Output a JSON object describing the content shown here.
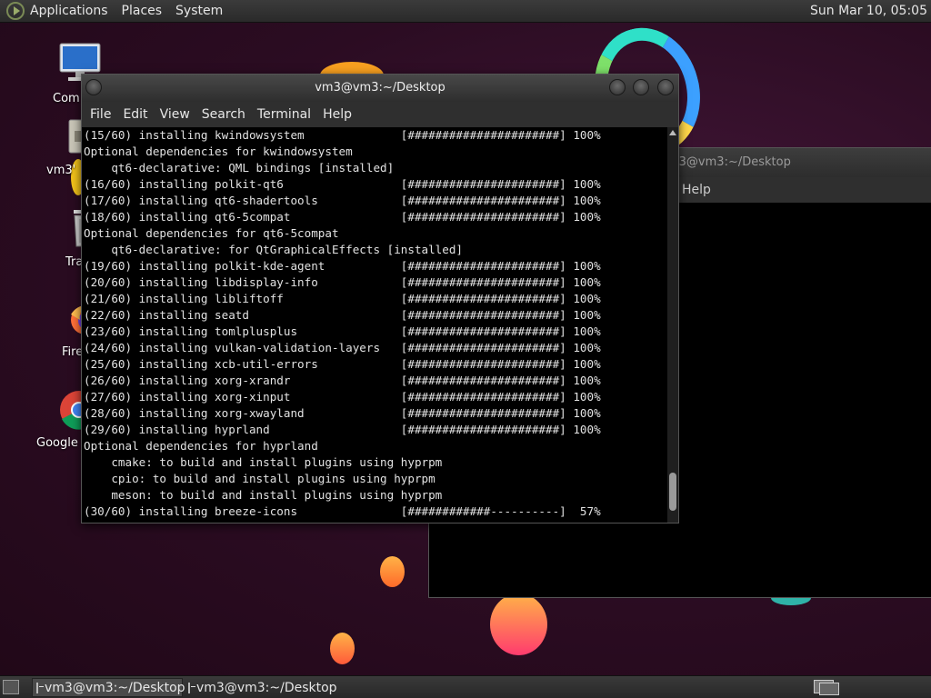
{
  "top_panel": {
    "menus": [
      "Applications",
      "Places",
      "System"
    ],
    "clock": "Sun Mar 10, 05:05"
  },
  "desktop_icons": [
    {
      "label": "Com",
      "icon": "computer-icon"
    },
    {
      "label": "vm3'",
      "icon": "home-folder-icon"
    },
    {
      "label": "Tra",
      "icon": "trash-icon"
    },
    {
      "label": "Fire",
      "icon": "firefox-icon"
    },
    {
      "label": "Google",
      "icon": "chrome-icon"
    }
  ],
  "terminal_front": {
    "title": "vm3@vm3:~/Desktop",
    "menu": [
      "File",
      "Edit",
      "View",
      "Search",
      "Terminal",
      "Help"
    ],
    "lines": [
      "(15/60) installing kwindowsystem              [######################] 100%",
      "Optional dependencies for kwindowsystem",
      "    qt6-declarative: QML bindings [installed]",
      "(16/60) installing polkit-qt6                 [######################] 100%",
      "(17/60) installing qt6-shadertools            [######################] 100%",
      "(18/60) installing qt6-5compat                [######################] 100%",
      "Optional dependencies for qt6-5compat",
      "    qt6-declarative: for QtGraphicalEffects [installed]",
      "(19/60) installing polkit-kde-agent           [######################] 100%",
      "(20/60) installing libdisplay-info            [######################] 100%",
      "(21/60) installing libliftoff                 [######################] 100%",
      "(22/60) installing seatd                      [######################] 100%",
      "(23/60) installing tomlplusplus               [######################] 100%",
      "(24/60) installing vulkan-validation-layers   [######################] 100%",
      "(25/60) installing xcb-util-errors            [######################] 100%",
      "(26/60) installing xorg-xrandr                [######################] 100%",
      "(27/60) installing xorg-xinput                [######################] 100%",
      "(28/60) installing xorg-xwayland              [######################] 100%",
      "(29/60) installing hyprland                   [######################] 100%",
      "Optional dependencies for hyprland",
      "    cmake: to build and install plugins using hyprpm",
      "    cpio: to build and install plugins using hyprpm",
      "    meson: to build and install plugins using hyprpm",
      "(30/60) installing breeze-icons               [############----------]  57%"
    ]
  },
  "terminal_back": {
    "title": "m3@vm3:~/Desktop",
    "menu_visible": "Help"
  },
  "taskbar": {
    "tasks": [
      "vm3@vm3:~/Desktop",
      "vm3@vm3:~/Desktop"
    ]
  },
  "colors": {
    "wallpaper": "#2b0c22",
    "panel": "#2f2f2f",
    "terminal_bg": "#000000",
    "terminal_fg": "#e2e2e2"
  }
}
